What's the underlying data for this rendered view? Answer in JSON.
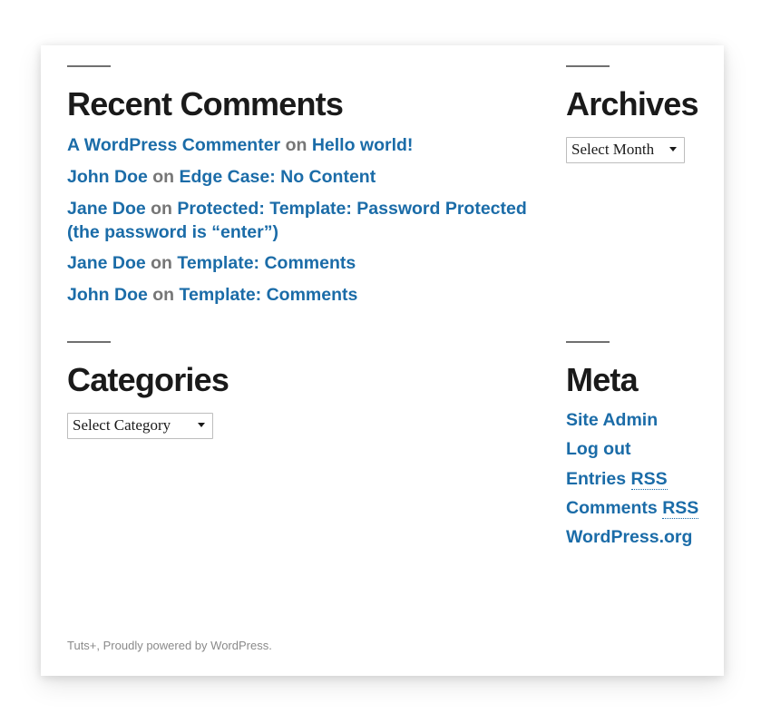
{
  "theme": {
    "link_color": "#1b6ca8",
    "text_color": "#1a1a1a",
    "muted_color": "#767676",
    "rule_color": "#707070",
    "card_background": "#ffffff",
    "page_background": "#ffffff"
  },
  "widgets": {
    "recent_comments": {
      "title": "Recent Comments",
      "separator": "on",
      "items": [
        {
          "author": "A WordPress Commenter",
          "post": "Hello world!"
        },
        {
          "author": "John Doe",
          "post": "Edge Case: No Content"
        },
        {
          "author": "Jane Doe",
          "post": "Protected: Template: Password Protected (the password is “enter”)"
        },
        {
          "author": "Jane Doe",
          "post": "Template: Comments"
        },
        {
          "author": "John Doe",
          "post": "Template: Comments"
        }
      ]
    },
    "archives": {
      "title": "Archives",
      "select": {
        "selected": "Select Month",
        "options": [
          "Select Month"
        ],
        "caret_icon": "chevron-down-icon"
      }
    },
    "categories": {
      "title": "Categories",
      "select": {
        "selected": "Select Category",
        "options": [
          "Select Category"
        ],
        "caret_icon": "chevron-down-icon"
      }
    },
    "meta": {
      "title": "Meta",
      "items": [
        {
          "label": "Site Admin",
          "abbr": ""
        },
        {
          "label": "Log out",
          "abbr": ""
        },
        {
          "label": "Entries ",
          "abbr": "RSS"
        },
        {
          "label": "Comments ",
          "abbr": "RSS"
        },
        {
          "label": "WordPress.org",
          "abbr": ""
        }
      ]
    }
  },
  "footer": {
    "site_name": "Tuts+",
    "separator": ", ",
    "credit_prefix": "Proudly powered by ",
    "credit_link": "WordPress",
    "credit_suffix": "."
  }
}
